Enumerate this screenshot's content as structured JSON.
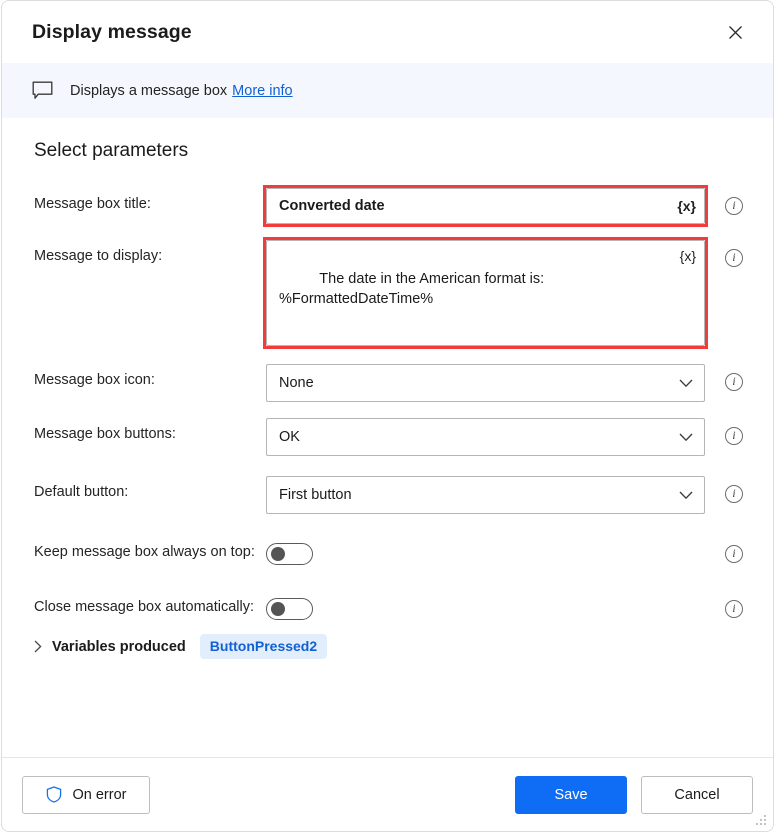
{
  "window": {
    "title": "Display message",
    "close_icon": "close-icon"
  },
  "banner": {
    "icon": "message-bubble-icon",
    "text": "Displays a message box",
    "link_label": "More info"
  },
  "form": {
    "section_title": "Select parameters",
    "fields": [
      {
        "label": "Message box title:",
        "value": "Converted date",
        "variable_button": "{x}",
        "info_icon": "info-icon"
      },
      {
        "label": "Message to display:",
        "value": "The date in the American format is:\n%FormattedDateTime%",
        "variable_button": "{x}",
        "info_icon": "info-icon"
      },
      {
        "label": "Message box icon:",
        "value": "None",
        "info_icon": "info-icon"
      },
      {
        "label": "Message box buttons:",
        "value": "OK",
        "info_icon": "info-icon"
      },
      {
        "label": "Default button:",
        "value": "First button",
        "info_icon": "info-icon"
      },
      {
        "label": "Keep message box always on top:",
        "value": "off",
        "info_icon": "info-icon"
      },
      {
        "label": "Close message box automatically:",
        "value": "off",
        "info_icon": "info-icon"
      }
    ],
    "variables_produced": {
      "expander_icon": "chevron-right-icon",
      "label": "Variables produced",
      "chip": "ButtonPressed2"
    }
  },
  "footer": {
    "on_error_label": "On error",
    "on_error_icon": "shield-icon",
    "save_label": "Save",
    "cancel_label": "Cancel",
    "resize_grip": "resize-grip-icon"
  },
  "colors": {
    "accent": "#0f6cf5",
    "link": "#1160d4",
    "annotation": "#f23b3b",
    "banner_bg": "#f4f8fe",
    "chip_bg": "#e3eefc"
  }
}
